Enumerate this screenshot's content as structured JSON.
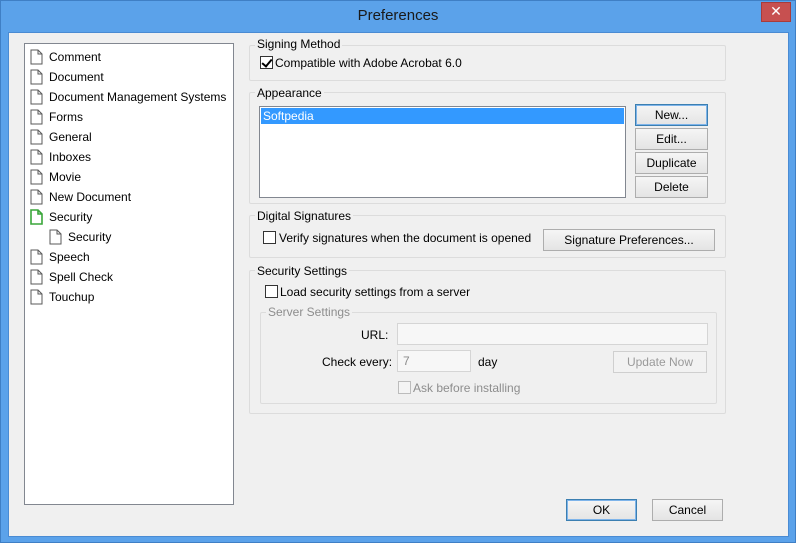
{
  "window": {
    "title": "Preferences",
    "close_glyph": "✕"
  },
  "tree": {
    "items": [
      {
        "label": "Comment",
        "icon": "page-icon"
      },
      {
        "label": "Document",
        "icon": "page-icon"
      },
      {
        "label": "Document Management Systems",
        "icon": "page-icon"
      },
      {
        "label": "Forms",
        "icon": "page-icon"
      },
      {
        "label": "General",
        "icon": "page-icon"
      },
      {
        "label": "Inboxes",
        "icon": "page-icon"
      },
      {
        "label": "Movie",
        "icon": "page-icon"
      },
      {
        "label": "New Document",
        "icon": "page-icon"
      },
      {
        "label": "Security",
        "icon": "page-icon-selected"
      },
      {
        "label": "Security",
        "icon": "page-icon"
      },
      {
        "label": "Speech",
        "icon": "page-icon"
      },
      {
        "label": "Spell Check",
        "icon": "page-icon"
      },
      {
        "label": "Touchup",
        "icon": "page-icon"
      }
    ]
  },
  "signing_method": {
    "legend": "Signing Method",
    "checkbox_label": "Compatible with Adobe Acrobat 6.0",
    "checked": true
  },
  "appearance": {
    "legend": "Appearance",
    "list": [
      "Softpedia"
    ],
    "buttons": {
      "new": "New...",
      "edit": "Edit...",
      "duplicate": "Duplicate",
      "delete": "Delete"
    }
  },
  "digital_signatures": {
    "legend": "Digital Signatures",
    "verify_label": "Verify signatures when the document is opened",
    "verify_checked": false,
    "preferences_button": "Signature Preferences..."
  },
  "security_settings": {
    "legend": "Security Settings",
    "load_label": "Load security settings from a server",
    "load_checked": false,
    "server": {
      "legend": "Server Settings",
      "url_label": "URL:",
      "url_value": "",
      "check_every_label": "Check every:",
      "check_every_value": "7",
      "unit": "day",
      "update_button": "Update Now",
      "ask_label": "Ask before installing"
    }
  },
  "footer": {
    "ok": "OK",
    "cancel": "Cancel"
  },
  "colors": {
    "title_bar": "#5ba2ea",
    "selection": "#3399ff",
    "close": "#c75050",
    "selected_icon": "#3aa63a"
  }
}
